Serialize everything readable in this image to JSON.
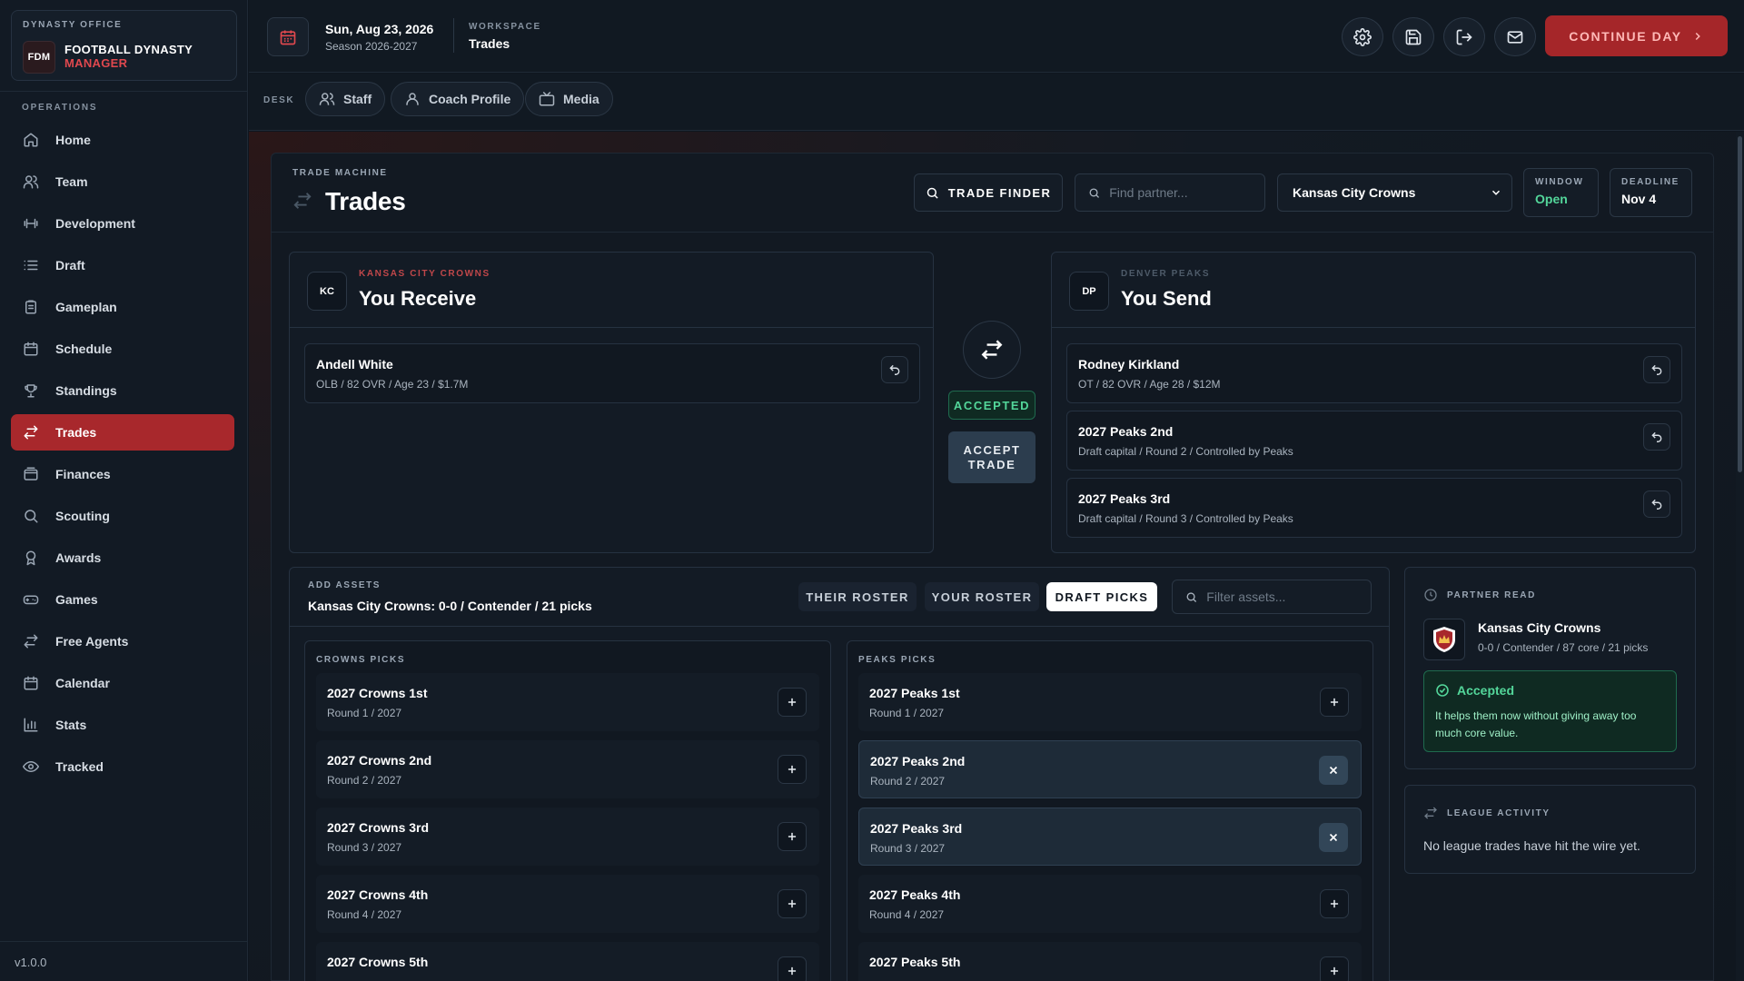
{
  "brand": {
    "eyebrow": "DYNASTY OFFICE",
    "logo": "FDM",
    "name": "FOOTBALL DYNASTY",
    "sub": "MANAGER"
  },
  "sidebar": {
    "section_label": "OPERATIONS",
    "items": [
      {
        "label": "Home",
        "icon": "home-icon"
      },
      {
        "label": "Team",
        "icon": "users-icon"
      },
      {
        "label": "Development",
        "icon": "dumbbell-icon"
      },
      {
        "label": "Draft",
        "icon": "list-icon"
      },
      {
        "label": "Gameplan",
        "icon": "clipboard-icon"
      },
      {
        "label": "Schedule",
        "icon": "calendar-icon"
      },
      {
        "label": "Standings",
        "icon": "trophy-icon"
      },
      {
        "label": "Trades",
        "icon": "swap-icon",
        "active": true
      },
      {
        "label": "Finances",
        "icon": "wallet-icon"
      },
      {
        "label": "Scouting",
        "icon": "search-icon"
      },
      {
        "label": "Awards",
        "icon": "award-icon"
      },
      {
        "label": "Games",
        "icon": "gamepad-icon"
      },
      {
        "label": "Free Agents",
        "icon": "swap-icon"
      },
      {
        "label": "Calendar",
        "icon": "calendar-icon"
      },
      {
        "label": "Stats",
        "icon": "bar-chart-icon"
      },
      {
        "label": "Tracked",
        "icon": "eye-icon"
      }
    ],
    "version": "v1.0.0"
  },
  "topbar": {
    "date": "Sun, Aug 23, 2026",
    "season": "Season 2026-2027",
    "workspace_label": "WORKSPACE",
    "workspace_value": "Trades",
    "continue_label": "CONTINUE DAY"
  },
  "desk": {
    "label": "DESK",
    "pills": [
      "Staff",
      "Coach Profile",
      "Media"
    ]
  },
  "trade_machine": {
    "eyebrow": "TRADE MACHINE",
    "title": "Trades",
    "finder_label": "TRADE FINDER",
    "partner_search_placeholder": "Find partner...",
    "selected_team": "Kansas City Crowns",
    "window_label": "WINDOW",
    "window_value": "Open",
    "deadline_label": "DEADLINE",
    "deadline_value": "Nov 4"
  },
  "receive": {
    "badge": "KC",
    "team": "KANSAS CITY CROWNS",
    "title": "You Receive",
    "assets": [
      {
        "name": "Andell White",
        "meta": "OLB / 82 OVR / Age 23 / $1.7M"
      }
    ]
  },
  "send": {
    "badge": "DP",
    "team": "DENVER PEAKS",
    "title": "You Send",
    "assets": [
      {
        "name": "Rodney Kirkland",
        "meta": "OT / 82 OVR / Age 28 / $12M"
      },
      {
        "name": "2027 Peaks 2nd",
        "meta": "Draft capital / Round 2 / Controlled by Peaks"
      },
      {
        "name": "2027 Peaks 3rd",
        "meta": "Draft capital / Round 3 / Controlled by Peaks"
      }
    ]
  },
  "status": {
    "badge": "ACCEPTED",
    "accept_label": "ACCEPT TRADE"
  },
  "add_assets": {
    "eyebrow": "ADD ASSETS",
    "summary": "Kansas City Crowns: 0-0 / Contender / 21 picks",
    "tabs": [
      "THEIR ROSTER",
      "YOUR ROSTER",
      "DRAFT PICKS"
    ],
    "filter_placeholder": "Filter assets...",
    "crowns_label": "CROWNS PICKS",
    "peaks_label": "PEAKS PICKS",
    "crowns_picks": [
      {
        "name": "2027 Crowns 1st",
        "meta": "Round 1 / 2027"
      },
      {
        "name": "2027 Crowns 2nd",
        "meta": "Round 2 / 2027"
      },
      {
        "name": "2027 Crowns 3rd",
        "meta": "Round 3 / 2027"
      },
      {
        "name": "2027 Crowns 4th",
        "meta": "Round 4 / 2027"
      },
      {
        "name": "2027 Crowns 5th",
        "meta": ""
      }
    ],
    "peaks_picks": [
      {
        "name": "2027 Peaks 1st",
        "meta": "Round 1 / 2027",
        "selected": false
      },
      {
        "name": "2027 Peaks 2nd",
        "meta": "Round 2 / 2027",
        "selected": true
      },
      {
        "name": "2027 Peaks 3rd",
        "meta": "Round 3 / 2027",
        "selected": true
      },
      {
        "name": "2027 Peaks 4th",
        "meta": "Round 4 / 2027",
        "selected": false
      },
      {
        "name": "2027 Peaks 5th",
        "meta": "",
        "selected": false
      }
    ]
  },
  "partner_read": {
    "label": "PARTNER READ",
    "team": "Kansas City Crowns",
    "meta": "0-0 / Contender / 87 core / 21 picks",
    "verdict": "Accepted",
    "verdict_text": "It helps them now without giving away too much core value."
  },
  "league_activity": {
    "label": "LEAGUE ACTIVITY",
    "text": "No league trades have hit the wire yet."
  },
  "colors": {
    "accent_red": "#a8282c",
    "accepted_green": "#53d69a",
    "crowns_red": "#c0474a",
    "peaks_gray": "#4e5b69"
  }
}
